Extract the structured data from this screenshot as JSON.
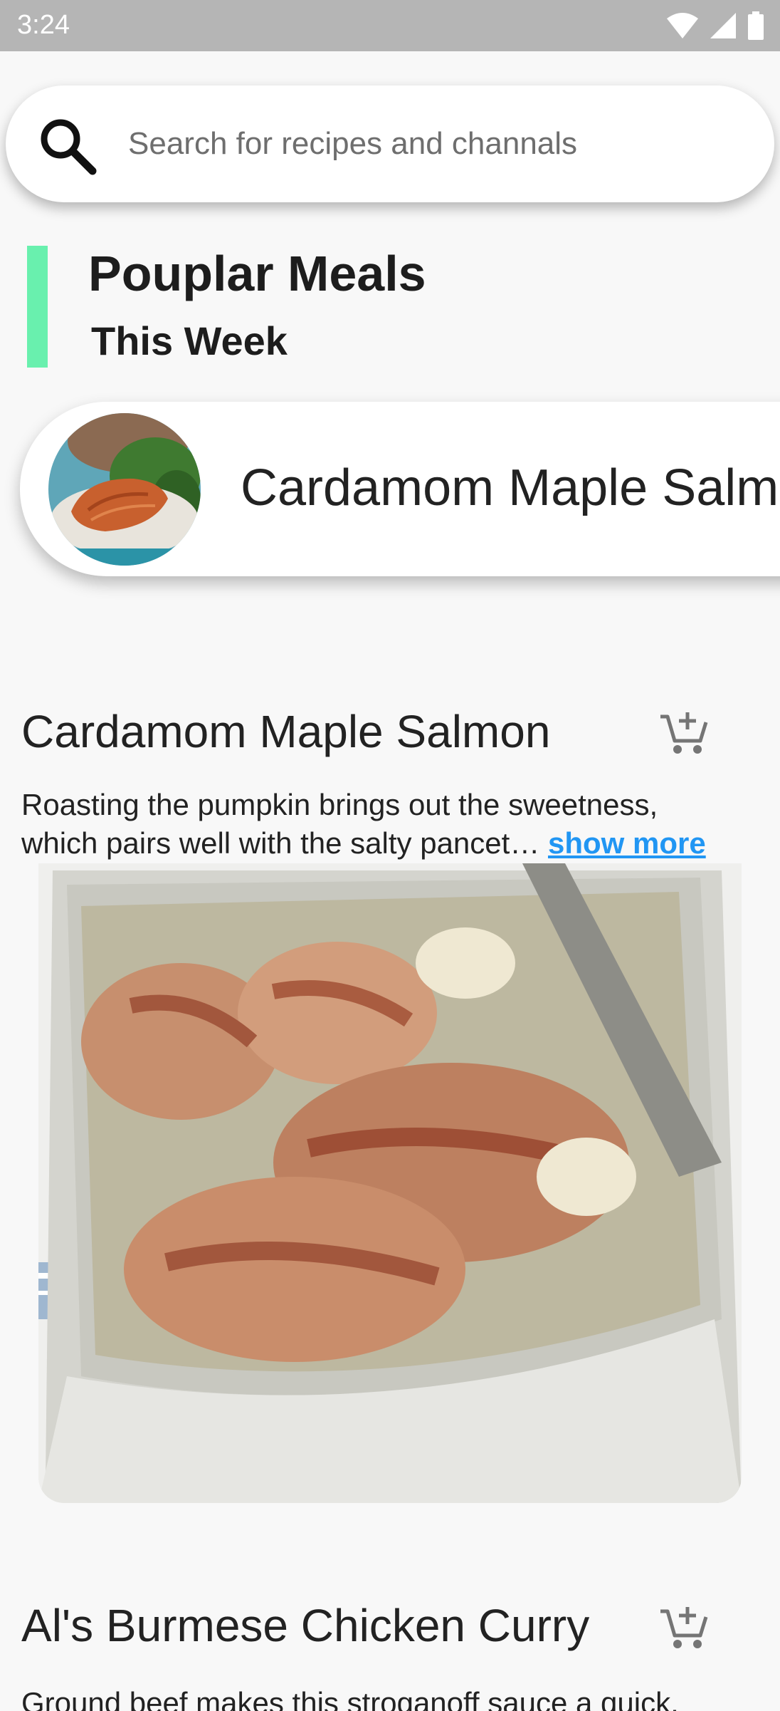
{
  "status_bar": {
    "time": "3:24"
  },
  "search": {
    "placeholder": "Search for recipes and channals"
  },
  "section": {
    "title": "Pouplar Meals",
    "subtitle": "This Week"
  },
  "featured": {
    "title": "Cardamom Maple Salmon"
  },
  "recipes": [
    {
      "title": "Cardamom Maple Salmon",
      "desc_line1": "Roasting the pumpkin brings out the sweetness,",
      "desc_line2": "which pairs well with the salty pancet… ",
      "show_more": "show more"
    },
    {
      "title": "Al's Burmese Chicken Curry",
      "desc_line1": "Ground beef makes this stroganoff sauce a quick,"
    }
  ],
  "colors": {
    "accent": "#69f0ae",
    "link": "#2196f3",
    "status_bar": "#b5b5b5"
  },
  "icons": [
    "search-icon",
    "wifi-icon",
    "signal-icon",
    "battery-icon",
    "add-to-cart-icon"
  ]
}
